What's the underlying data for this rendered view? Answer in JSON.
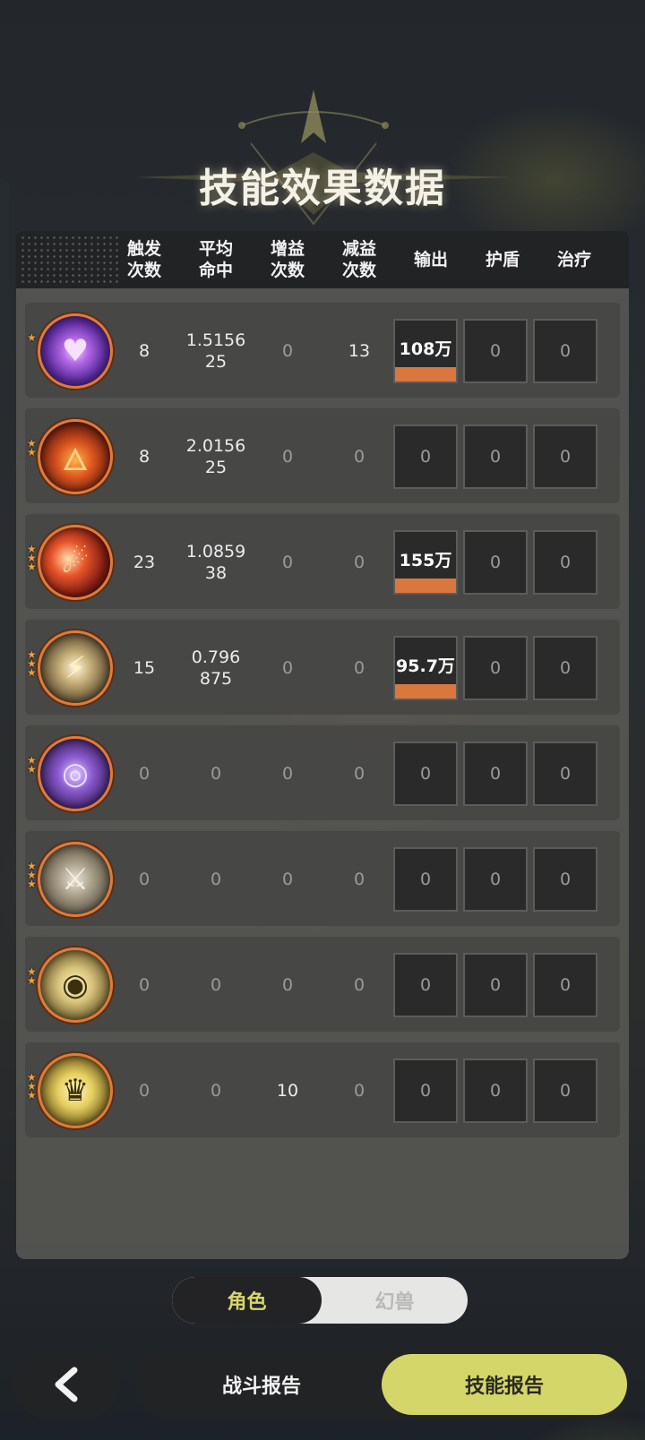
{
  "title": "技能效果数据",
  "columns": {
    "triggers": "触发\n次数",
    "avg_hit": "平均\n命中",
    "buff": "增益\n次数",
    "debuff": "减益\n次数",
    "output": "输出",
    "shield": "护盾",
    "heal": "治疗"
  },
  "rows": [
    {
      "icon": "purple-heart-skill-icon",
      "stars": 1,
      "triggers": "8",
      "avg_hit": "1.5156\n25",
      "buff": "0",
      "debuff": "13",
      "output": "108万",
      "output_fill": 1.0,
      "shield": "0",
      "heal": "0"
    },
    {
      "icon": "fire-flame-skill-icon",
      "stars": 2,
      "triggers": "8",
      "avg_hit": "2.0156\n25",
      "buff": "0",
      "debuff": "0",
      "output": "0",
      "output_fill": 0,
      "shield": "0",
      "heal": "0"
    },
    {
      "icon": "fire-slash-skill-icon",
      "stars": 3,
      "triggers": "23",
      "avg_hit": "1.0859\n38",
      "buff": "0",
      "debuff": "0",
      "output": "155万",
      "output_fill": 1.0,
      "shield": "0",
      "heal": "0"
    },
    {
      "icon": "lightning-strike-skill-icon",
      "stars": 3,
      "triggers": "15",
      "avg_hit": "0.796\n875",
      "buff": "0",
      "debuff": "0",
      "output": "95.7万",
      "output_fill": 1.0,
      "shield": "0",
      "heal": "0"
    },
    {
      "icon": "arcane-orb-skill-icon",
      "stars": 2,
      "triggers": "0",
      "avg_hit": "0",
      "buff": "0",
      "debuff": "0",
      "output": "0",
      "output_fill": 0,
      "shield": "0",
      "heal": "0"
    },
    {
      "icon": "sword-up-skill-icon",
      "stars": 3,
      "triggers": "0",
      "avg_hit": "0",
      "buff": "0",
      "debuff": "0",
      "output": "0",
      "output_fill": 0,
      "shield": "0",
      "heal": "0"
    },
    {
      "icon": "eye-skill-icon",
      "stars": 2,
      "triggers": "0",
      "avg_hit": "0",
      "buff": "0",
      "debuff": "0",
      "output": "0",
      "output_fill": 0,
      "shield": "0",
      "heal": "0"
    },
    {
      "icon": "golden-spirit-skill-icon",
      "stars": 3,
      "triggers": "0",
      "avg_hit": "0",
      "buff": "10",
      "debuff": "0",
      "output": "0",
      "output_fill": 0,
      "shield": "0",
      "heal": "0"
    }
  ],
  "toggle": {
    "active": "角色",
    "inactive": "幻兽"
  },
  "nav": {
    "battle_report": "战斗报告",
    "skill_report": "技能报告"
  },
  "colors": {
    "accent": "#d4d66a",
    "output_bar": "#d9773f",
    "icon_ring": "#e07a3a"
  }
}
